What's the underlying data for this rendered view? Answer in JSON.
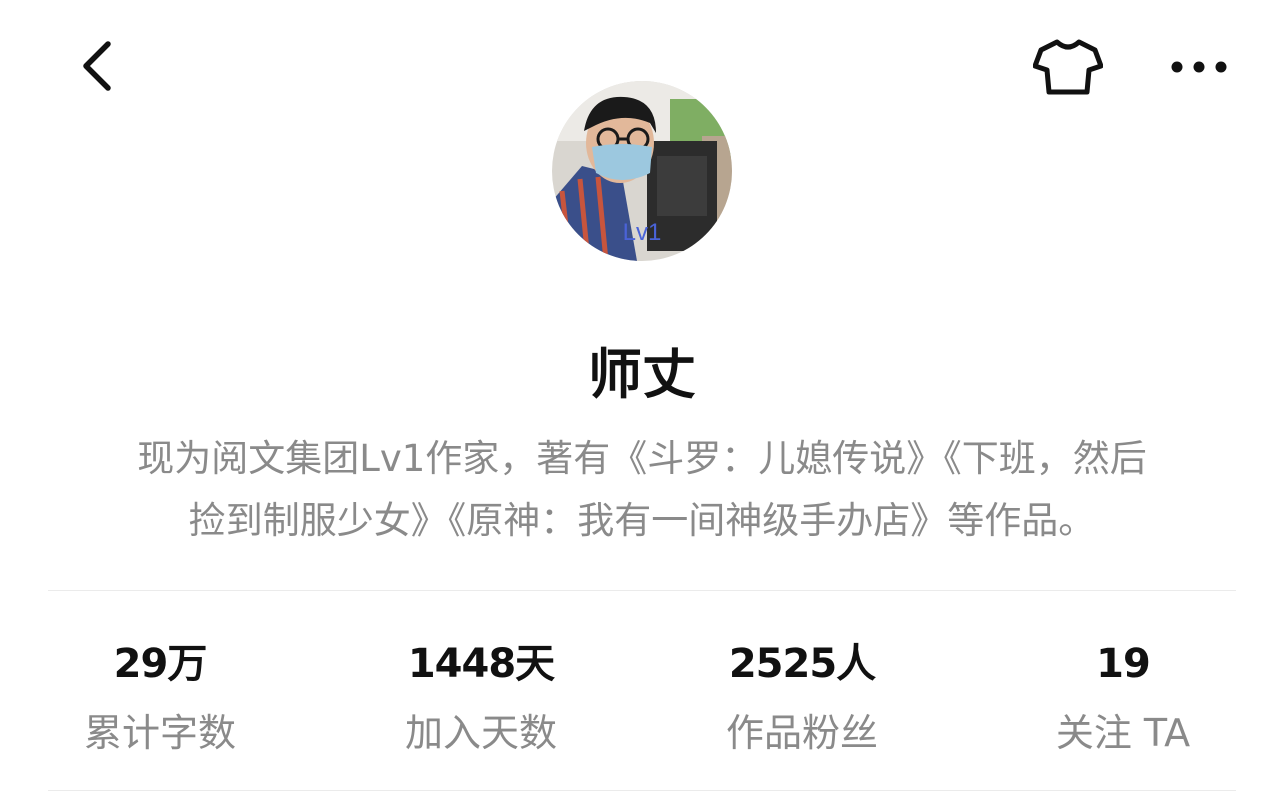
{
  "header": {
    "back_icon": "chevron-left-icon",
    "skin_icon": "tshirt-icon",
    "more_icon": "more-horizontal-icon"
  },
  "profile": {
    "avatar_badge": "Lv1",
    "name": "师丈",
    "bio_line1": "现为阅文集团Lv1作家，著有《斗罗：儿媳传说》《下班，然后",
    "bio_line2": "捡到制服少女》《原神：我有一间神级手办店》等作品。"
  },
  "stats": [
    {
      "value": "29万",
      "label": "累计字数"
    },
    {
      "value": "1448天",
      "label": "加入天数"
    },
    {
      "value": "2525人",
      "label": "作品粉丝"
    },
    {
      "value": "19",
      "label": "关注 TA"
    }
  ],
  "colors": {
    "text_primary": "#111111",
    "text_secondary": "#8a8a8a",
    "divider": "#ebebeb",
    "badge": "#4a63d8"
  }
}
